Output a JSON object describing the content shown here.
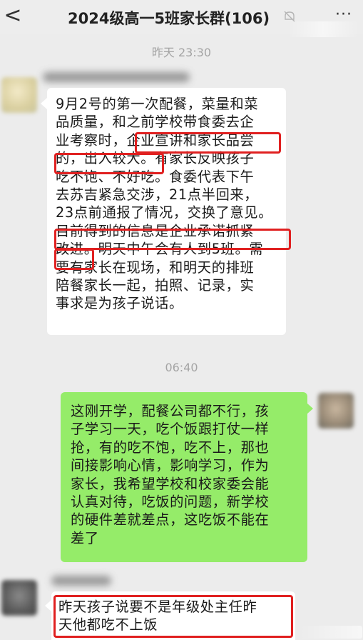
{
  "header": {
    "back_symbol": "<",
    "title": "2024级高一5班家长群(106)",
    "more_symbol": "···",
    "accent_color": "#07c160",
    "icons": [
      "chevron-left-icon",
      "mute-icon",
      "more-icon"
    ]
  },
  "chat": {
    "time_1": "昨天 23:30",
    "time_2": "06:40",
    "message_1": {
      "lines": [
        "9月2号的第一次配餐，菜量和菜",
        "品质量，和之前学校带食委去企",
        "业考察时，企业宣讲和家长品尝",
        "的，出入较大。有家长反映孩子",
        "吃不饱、不好吃。食委代表下午",
        "去苏吉紧急交涉，21点半回来，",
        "23点前通报了情况，交换了意见。",
        "目前得到的信息是企业承诺抓紧",
        "改进。明天中午会有人到5班。需",
        "要有家长在现场，和明天的排班",
        "陪餐家长一起，拍照、记录，实",
        "事求是为孩子说话。"
      ]
    },
    "message_2": {
      "lines": [
        "这刚开学，配餐公司都不行，孩",
        "子学习一天，吃个饭跟打仗一样",
        "抢，有的吃不饱，吃不上，那也",
        "间接影响心情，影响学习，作为",
        "家长，我希望学校和校家委会能",
        "认真对待，吃饭的问题，新学校",
        "的硬件差就差点，这吃饭不能在",
        "差了"
      ]
    },
    "message_3": {
      "lines": [
        "昨天孩子说要不是年级处主任昨",
        "天他都吃不上饭"
      ]
    },
    "colors": {
      "received_bubble": "#ffffff",
      "sent_bubble": "#95ec69",
      "highlight_box": "#e02020"
    }
  }
}
